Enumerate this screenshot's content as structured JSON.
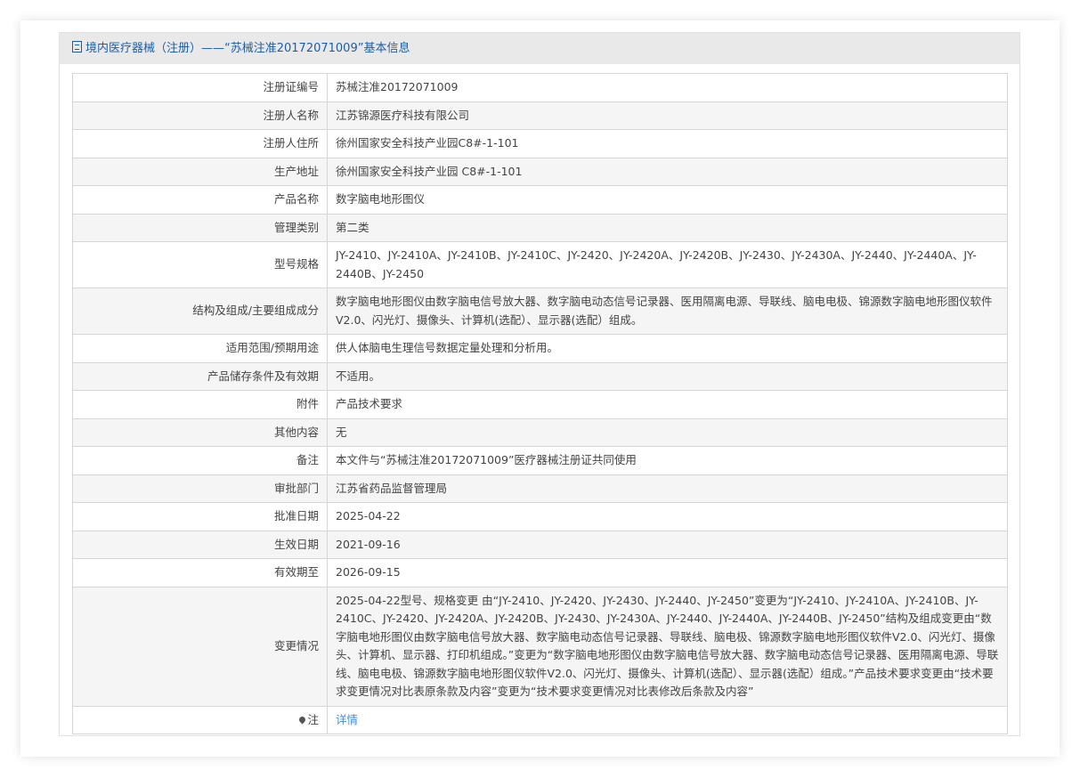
{
  "header": {
    "title": "境内医疗器械（注册）——“苏械注准20172071009”基本信息"
  },
  "rows": [
    {
      "label": "注册证编号",
      "value": "苏械注准20172071009"
    },
    {
      "label": "注册人名称",
      "value": "江苏锦源医疗科技有限公司"
    },
    {
      "label": "注册人住所",
      "value": "徐州国家安全科技产业园C8#-1-101"
    },
    {
      "label": "生产地址",
      "value": "徐州国家安全科技产业园 C8#-1-101"
    },
    {
      "label": "产品名称",
      "value": "数字脑电地形图仪"
    },
    {
      "label": "管理类别",
      "value": "第二类"
    },
    {
      "label": "型号规格",
      "value": "JY-2410、JY-2410A、JY-2410B、JY-2410C、JY-2420、JY-2420A、JY-2420B、JY-2430、JY-2430A、JY-2440、JY-2440A、JY-2440B、JY-2450"
    },
    {
      "label": "结构及组成/主要组成成分",
      "value": "数字脑电地形图仪由数字脑电信号放大器、数字脑电动态信号记录器、医用隔离电源、导联线、脑电电极、锦源数字脑电地形图仪软件V2.0、闪光灯、摄像头、计算机(选配）、显示器(选配）组成。"
    },
    {
      "label": "适用范围/预期用途",
      "value": "供人体脑电生理信号数据定量处理和分析用。"
    },
    {
      "label": "产品储存条件及有效期",
      "value": "不适用。"
    },
    {
      "label": "附件",
      "value": "产品技术要求"
    },
    {
      "label": "其他内容",
      "value": "无"
    },
    {
      "label": "备注",
      "value": "本文件与“苏械注准20172071009”医疗器械注册证共同使用"
    },
    {
      "label": "审批部门",
      "value": "江苏省药品监督管理局"
    },
    {
      "label": "批准日期",
      "value": "2025-04-22"
    },
    {
      "label": "生效日期",
      "value": "2021-09-16"
    },
    {
      "label": "有效期至",
      "value": "2026-09-15"
    },
    {
      "label": "变更情况",
      "value": "2025-04-22型号、规格变更 由“JY-2410、JY-2420、JY-2430、JY-2440、JY-2450”变更为“JY-2410、JY-2410A、JY-2410B、JY-2410C、JY-2420、JY-2420A、JY-2420B、JY-2430、JY-2430A、JY-2440、JY-2440A、JY-2440B、JY-2450”结构及组成变更由“数字脑电地形图仪由数字脑电信号放大器、数字脑电动态信号记录器、导联线、脑电极、锦源数字脑电地形图仪软件V2.0、闪光灯、摄像头、计算机、显示器、打印机组成。”变更为“数字脑电地形图仪由数字脑电信号放大器、数字脑电动态信号记录器、医用隔离电源、导联线、脑电电极、锦源数字脑电地形图仪软件V2.0、闪光灯、摄像头、计算机(选配）、显示器(选配）组成。”产品技术要求变更由“技术要求变更情况对比表原条款及内容”变更为“技术要求变更情况对比表修改后条款及内容”"
    }
  ],
  "note": {
    "label": "注",
    "link": "详情"
  }
}
